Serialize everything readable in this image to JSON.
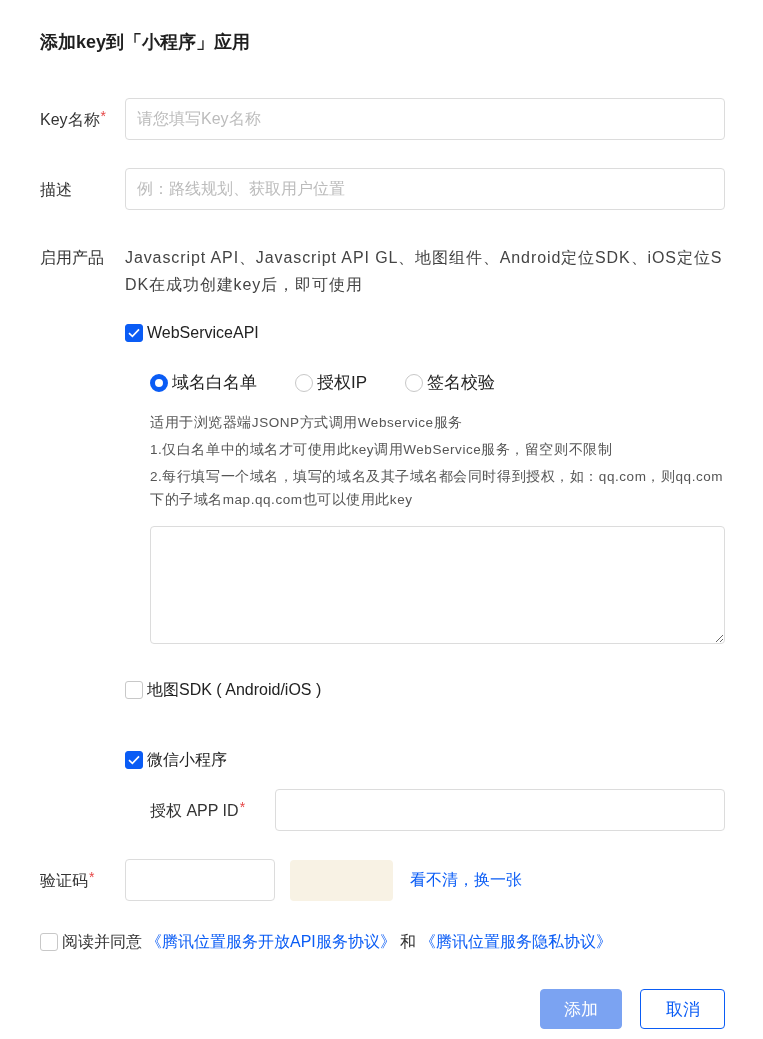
{
  "title": "添加key到「小程序」应用",
  "fields": [
    {
      "kind": "input",
      "label": "Key名称",
      "required_mark": "*",
      "placeholder": "请您填写Key名称"
    },
    {
      "kind": "input",
      "label": "描述",
      "placeholder": "例：路线规划、获取用户位置"
    }
  ],
  "products": {
    "label": "启用产品",
    "note": "Javascript API、Javascript API GL、地图组件、Android定位SDK、iOS定位SDK在成功创建key后，即可使用",
    "options": [
      {
        "kind": "webservice",
        "label": "WebServiceAPI",
        "checked": true,
        "modes": [
          {
            "label": "域名白名单",
            "selected": true
          },
          {
            "label": "授权IP",
            "selected": false
          },
          {
            "label": "签名校验",
            "selected": false
          }
        ],
        "help": [
          "适用于浏览器端JSONP方式调用Webservice服务",
          "1.仅白名单中的域名才可使用此key调用WebService服务，留空则不限制",
          "2.每行填写一个域名，填写的域名及其子域名都会同时得到授权，如：qq.com，则qq.com下的子域名map.qq.com也可以使用此key"
        ]
      },
      {
        "kind": "plain",
        "label": "地图SDK ( Android/iOS )",
        "checked": false
      },
      {
        "kind": "miniprogram",
        "label": "微信小程序",
        "checked": true,
        "app_id": {
          "label": "授权 APP ID",
          "required_mark": "*"
        }
      }
    ]
  },
  "captcha": {
    "label": "验证码",
    "required_mark": "*",
    "refresh_link": "看不清，换一张"
  },
  "agreement": {
    "checked": false,
    "prefix": "阅读并同意",
    "links": [
      "《腾讯位置服务开放API服务协议》",
      "《腾讯位置服务隐私协议》"
    ],
    "joiner": "和"
  },
  "buttons": [
    {
      "kind": "primary",
      "label": "添加",
      "disabled": true
    },
    {
      "kind": "secondary",
      "label": "取消",
      "disabled": false
    }
  ]
}
